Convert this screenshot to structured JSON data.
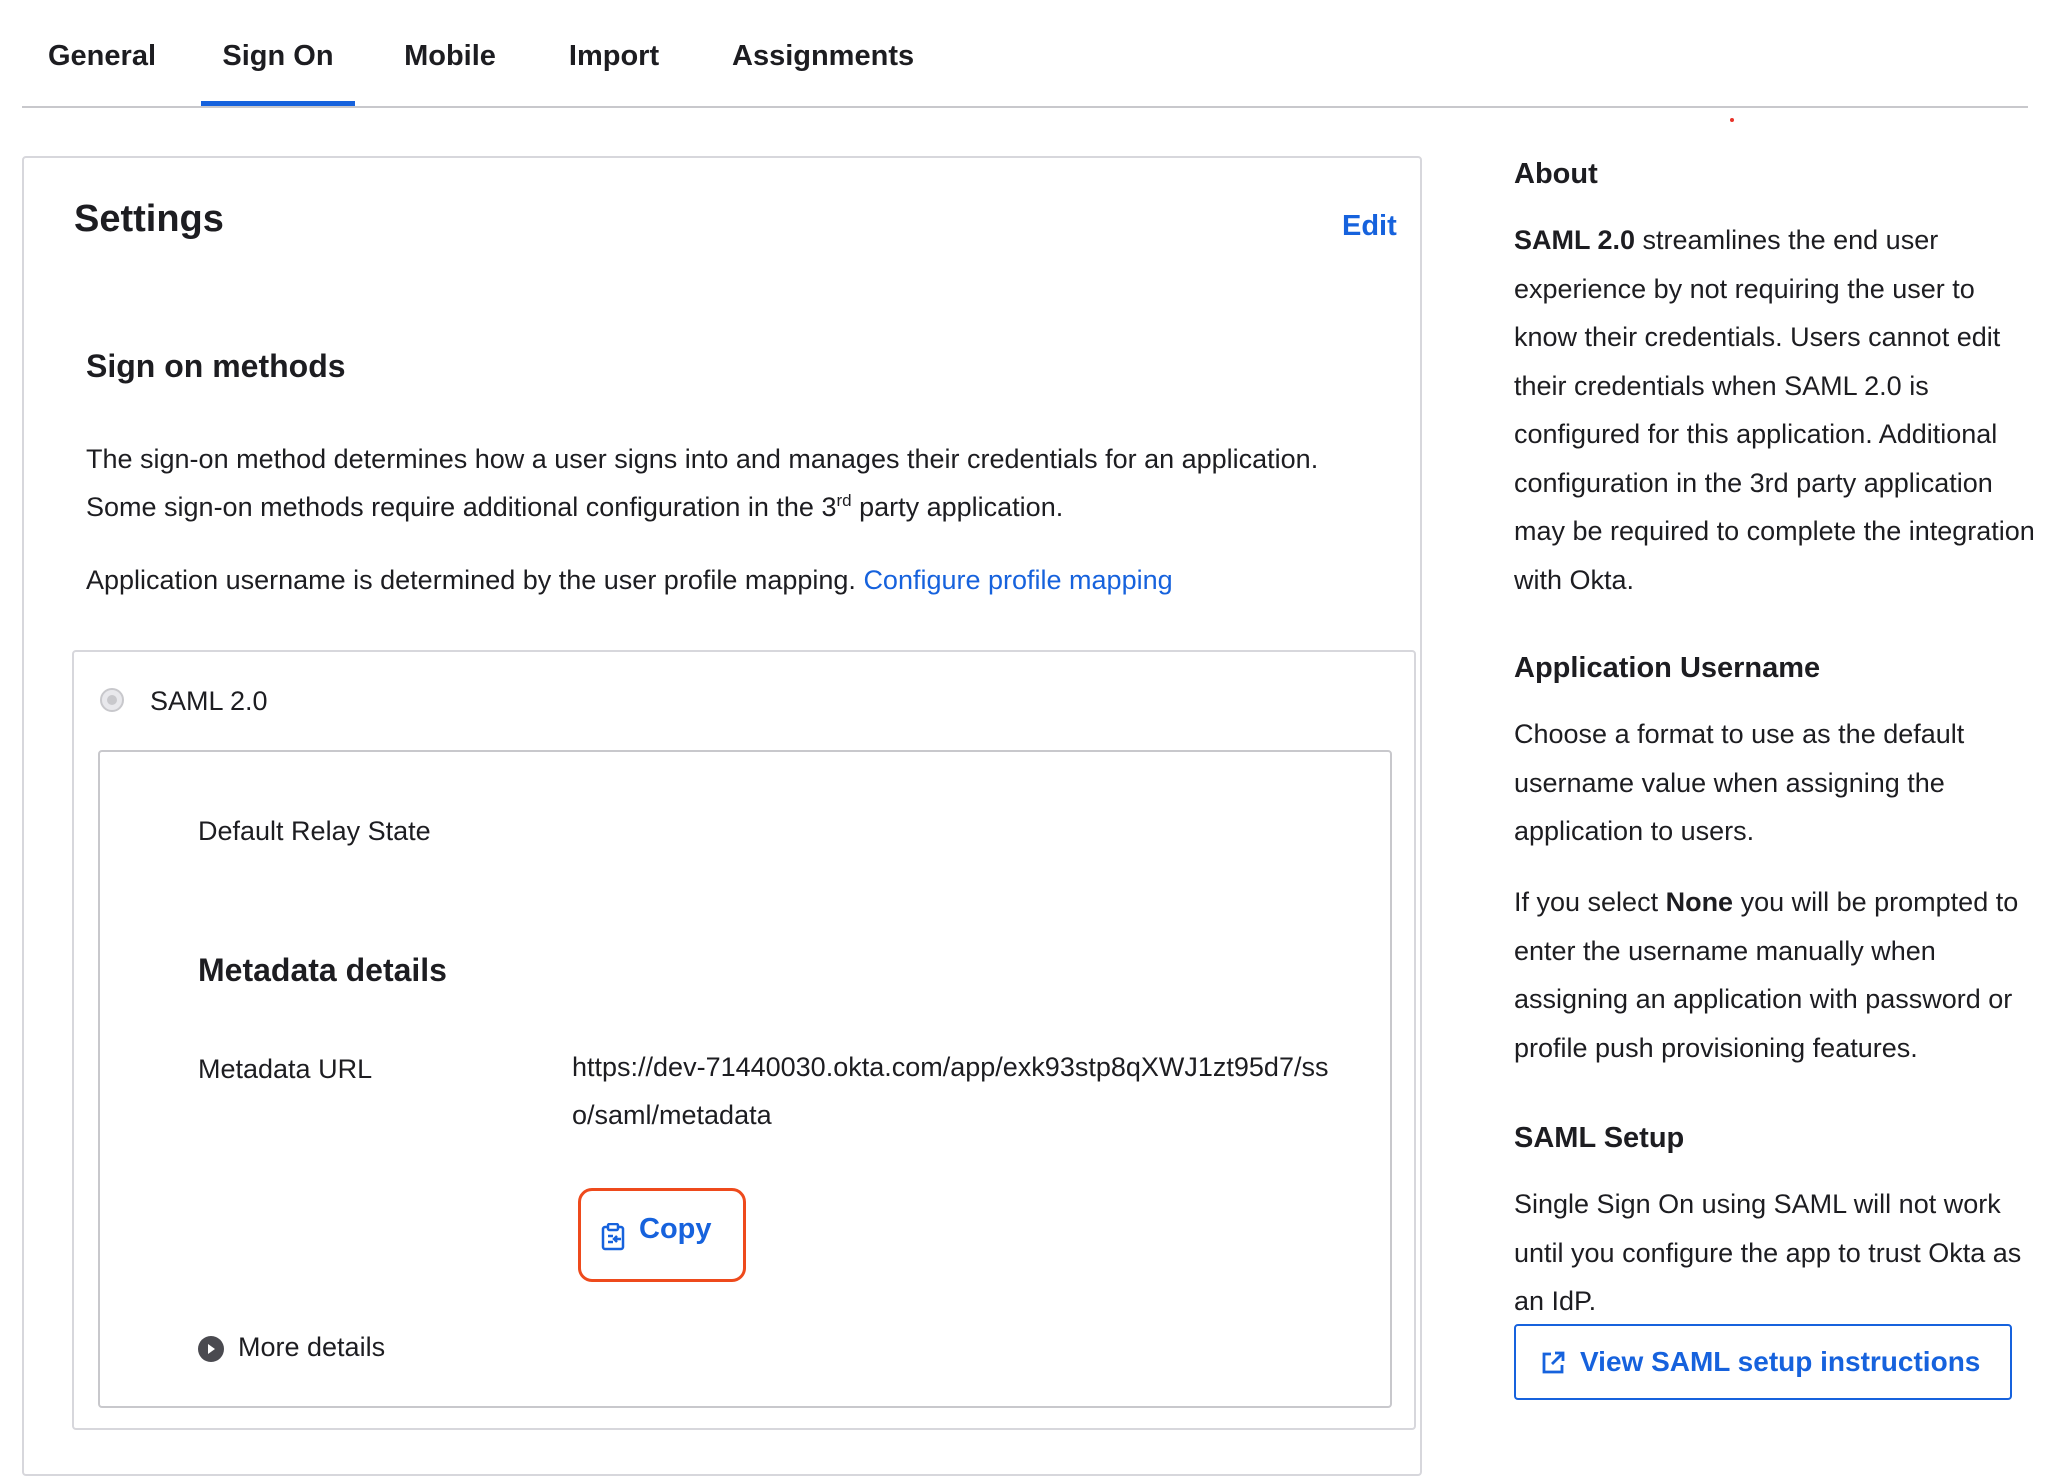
{
  "tabs": [
    {
      "label": "General",
      "active": false
    },
    {
      "label": "Sign On",
      "active": true
    },
    {
      "label": "Mobile",
      "active": false
    },
    {
      "label": "Import",
      "active": false
    },
    {
      "label": "Assignments",
      "active": false
    }
  ],
  "settings": {
    "title": "Settings",
    "edit_label": "Edit",
    "sign_on_methods": {
      "heading": "Sign on methods",
      "description_part1": "The sign-on method determines how a user signs into and manages their credentials for an application. Some sign-on methods require additional configuration in the 3",
      "description_sup": "rd",
      "description_part2": " party application.",
      "username_text": "Application username is determined by the user profile mapping.",
      "configure_link": "Configure profile mapping"
    },
    "saml": {
      "option_label": "SAML 2.0",
      "default_relay_state_label": "Default Relay State",
      "metadata_heading": "Metadata details",
      "metadata_url_label": "Metadata URL",
      "metadata_url_value": "https://dev-71440030.okta.com/app/exk93stp8qXWJ1zt95d7/sso/saml/metadata",
      "copy_label": "Copy",
      "more_details_label": "More details"
    }
  },
  "sidebar": {
    "about": {
      "heading": "About",
      "bold_lead": "SAML 2.0",
      "text": " streamlines the end user experience by not requiring the user to know their credentials. Users cannot edit their credentials when SAML 2.0 is configured for this application. Additional configuration in the 3rd party application may be required to complete the integration with Okta."
    },
    "app_username": {
      "heading": "Application Username",
      "text1": "Choose a format to use as the default username value when assigning the application to users.",
      "text2_pre": "If you select ",
      "text2_bold": "None",
      "text2_post": " you will be prompted to enter the username manually when assigning an application with password or profile push provisioning features."
    },
    "saml_setup": {
      "heading": "SAML Setup",
      "text": "Single Sign On using SAML will not work until you configure the app to trust Okta as an IdP.",
      "button_label": "View SAML setup instructions"
    }
  },
  "colors": {
    "accent": "#1662dd",
    "highlight": "#ee4a1c"
  },
  "icons": {
    "copy": "clipboard-icon",
    "setup": "external-link-icon",
    "more": "chevron-right-circle-icon"
  }
}
